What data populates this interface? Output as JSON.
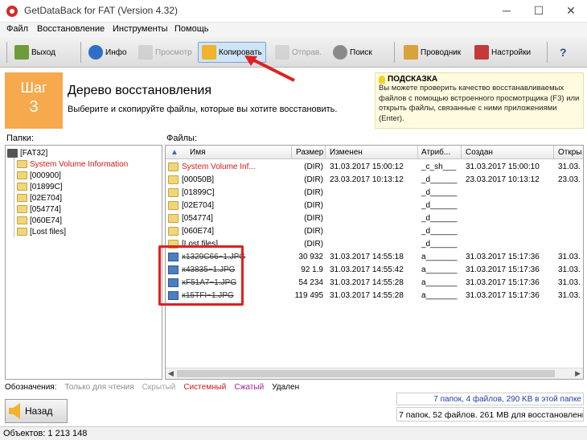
{
  "window": {
    "title": "GetDataBack for FAT (Version 4.32)",
    "minimize": "─",
    "maximize": "☐",
    "close": "✕"
  },
  "menu": [
    "Файл",
    "Восстановление",
    "Инструменты",
    "Помощь"
  ],
  "toolbar": {
    "exit": "Выход",
    "info": "Инфо",
    "preview": "Просмотр",
    "copy": "Копировать",
    "send": "Отправ.",
    "search": "Поиск",
    "explorer": "Проводник",
    "settings": "Настройки",
    "help": "?"
  },
  "step": {
    "label": "Шаг",
    "number": "3",
    "heading": "Дерево восстановления",
    "subtitle": "Выберите и скопируйте файлы, которые вы хотите восстановить."
  },
  "hint": {
    "title": "ПОДСКАЗКА",
    "body": "Вы можете проверить качество восстанавливаемых файлов с помощью встроенного просмотрщика (F3) или открыть файлы, связанные с ними приложениями (Enter)."
  },
  "tree": {
    "label": "Папки:",
    "root": "[FAT32]",
    "items": [
      {
        "name": "System Volume Information",
        "system": true
      },
      {
        "name": "[000900]"
      },
      {
        "name": "[01899C]"
      },
      {
        "name": "[02E704]"
      },
      {
        "name": "[054774]"
      },
      {
        "name": "[060E74]"
      },
      {
        "name": "[Lost files]"
      }
    ]
  },
  "files": {
    "label": "Файлы:",
    "columns": [
      "Имя",
      "Размер",
      "Изменен",
      "Атриб...",
      "Создан",
      "Откры"
    ],
    "rows": [
      {
        "name": "System Volume Inf...",
        "size": "(DIR)",
        "modified": "31.03.2017 15:00:12",
        "attr": "_c_sh___",
        "created": "31.03.2017 15:00:10",
        "opened": "31.03.",
        "kind": "folder",
        "style": "system"
      },
      {
        "name": "[00050B]",
        "size": "(DIR)",
        "modified": "23.03.2017 10:13:12",
        "attr": "_d______",
        "created": "23.03.2017 10:13:12",
        "opened": "23.03.",
        "kind": "folder",
        "style": ""
      },
      {
        "name": "[01899C]",
        "size": "(DIR)",
        "modified": "",
        "attr": "_d______",
        "created": "",
        "opened": "",
        "kind": "folder",
        "style": ""
      },
      {
        "name": "[02E704]",
        "size": "(DIR)",
        "modified": "",
        "attr": "_d______",
        "created": "",
        "opened": "",
        "kind": "folder",
        "style": ""
      },
      {
        "name": "[054774]",
        "size": "(DIR)",
        "modified": "",
        "attr": "_d______",
        "created": "",
        "opened": "",
        "kind": "folder",
        "style": ""
      },
      {
        "name": "[060E74]",
        "size": "(DIR)",
        "modified": "",
        "attr": "_d______",
        "created": "",
        "opened": "",
        "kind": "folder",
        "style": ""
      },
      {
        "name": "[Lost files]",
        "size": "(DIR)",
        "modified": "",
        "attr": "_d______",
        "created": "",
        "opened": "",
        "kind": "folder",
        "style": ""
      },
      {
        "name": "x1329C66~1.JPG",
        "size": "30 932",
        "modified": "31.03.2017 14:55:18",
        "attr": "a_______",
        "created": "31.03.2017 15:17:36",
        "opened": "31.03.",
        "kind": "img",
        "style": "deleted"
      },
      {
        "name": "x43835~1.JPG",
        "size": "92 1.9",
        "modified": "31.03.2017 14:55:42",
        "attr": "a_______",
        "created": "31.03.2017 15:17:36",
        "opened": "31.03.",
        "kind": "img",
        "style": "deleted"
      },
      {
        "name": "xF51A7~1.JPG",
        "size": "54 234",
        "modified": "31.03.2017 14:55:28",
        "attr": "a_______",
        "created": "31.03.2017 15:17:36",
        "opened": "31.03.",
        "kind": "img",
        "style": "deleted"
      },
      {
        "name": "x15TFI~1.JPG",
        "size": "119 495",
        "modified": "31.03.2017 14:55:28",
        "attr": "a_______",
        "created": "31.03.2017 15:17:36",
        "opened": "31.03.",
        "kind": "img",
        "style": "deleted"
      }
    ]
  },
  "legend": {
    "label": "Обозначения:",
    "items": [
      {
        "text": "Только для чтения",
        "color": "#8a8a8a"
      },
      {
        "text": "Скрытый",
        "color": "#a0a0a0"
      },
      {
        "text": "Системный",
        "color": "#d01818"
      },
      {
        "text": "Сжатый",
        "color": "#a020a0"
      },
      {
        "text": "Удален",
        "color": "#000000"
      }
    ]
  },
  "nav": {
    "back": "Назад"
  },
  "summary": {
    "selection": "7 папок, 4 файлов, 290 KB в этой папке",
    "total": "7 папок, 52 файлов. 261 MB для восстановления"
  },
  "status": "Объектов: 1 213 148"
}
